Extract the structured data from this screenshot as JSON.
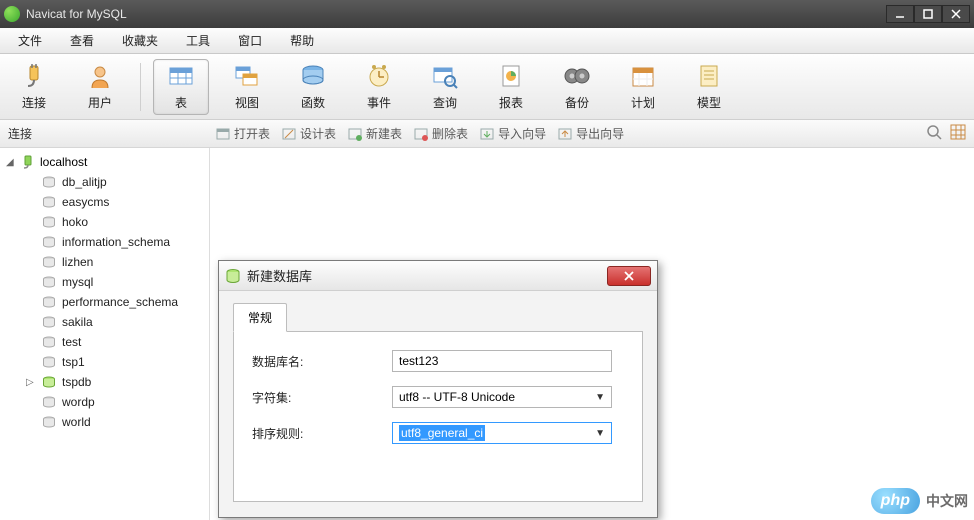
{
  "window": {
    "title": "Navicat for MySQL"
  },
  "menu": {
    "file": "文件",
    "view": "查看",
    "fav": "收藏夹",
    "tools": "工具",
    "window": "窗口",
    "help": "帮助"
  },
  "toolbar": {
    "connect": "连接",
    "user": "用户",
    "table": "表",
    "view": "视图",
    "func": "函数",
    "event": "事件",
    "query": "查询",
    "report": "报表",
    "backup": "备份",
    "plan": "计划",
    "model": "模型"
  },
  "subbar": {
    "label": "连接",
    "open": "打开表",
    "design": "设计表",
    "new": "新建表",
    "delete": "删除表",
    "import": "导入向导",
    "export": "导出向导"
  },
  "tree": {
    "host": "localhost",
    "dbs": [
      "db_alitjp",
      "easycms",
      "hoko",
      "information_schema",
      "lizhen",
      "mysql",
      "performance_schema",
      "sakila",
      "test",
      "tsp1",
      "tspdb",
      "wordp",
      "world"
    ],
    "expandable": "tspdb"
  },
  "dialog": {
    "title": "新建数据库",
    "tab": "常规",
    "fields": {
      "name_label": "数据库名:",
      "name_value": "test123",
      "charset_label": "字符集:",
      "charset_value": "utf8 -- UTF-8 Unicode",
      "collation_label": "排序规则:",
      "collation_value": "utf8_general_ci"
    }
  },
  "logo": {
    "brand": "php",
    "site": "中文网"
  }
}
